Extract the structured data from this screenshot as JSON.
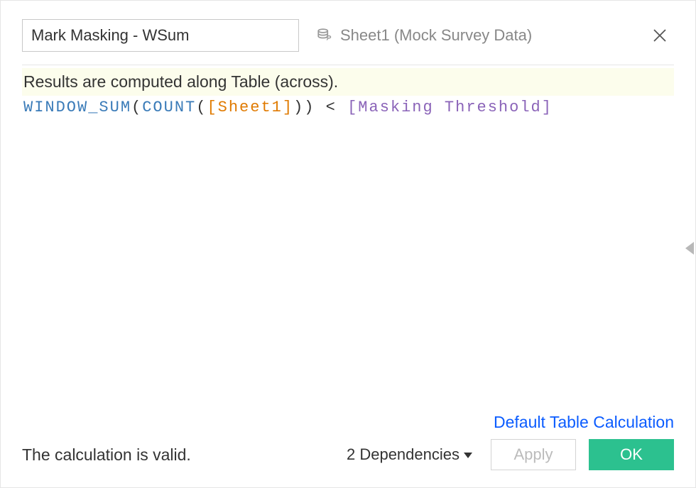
{
  "header": {
    "name_value": "Mark Masking - WSum",
    "datasource_label": "Sheet1 (Mock Survey Data)"
  },
  "editor": {
    "info_banner": "Results are computed along Table (across).",
    "formula": {
      "func1": "WINDOW_SUM",
      "open1": "(",
      "func2": "COUNT",
      "open2": "(",
      "field": "[Sheet1]",
      "close2": ")",
      "close1": ")",
      "op": " < ",
      "param": "[Masking Threshold]"
    }
  },
  "footer": {
    "table_calc_link": "Default Table Calculation",
    "status": "The calculation is valid.",
    "dependencies_label": "2 Dependencies",
    "apply_label": "Apply",
    "ok_label": "OK"
  }
}
